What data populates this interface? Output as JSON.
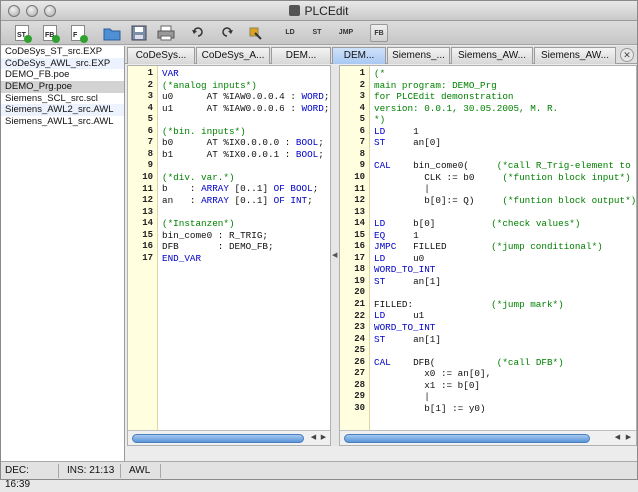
{
  "window": {
    "title": "PLCEdit"
  },
  "toolbar": {
    "new_st_label": "ST",
    "new_fb_label": "FB",
    "new_f_label": "F",
    "ld_label": "LD",
    "st_label": "ST",
    "jmp_label": "JMP",
    "fb_label": "FB"
  },
  "files": [
    "CoDeSys_ST_src.EXP",
    "CoDeSys_AWL_src.EXP",
    "DEMO_FB.poe",
    "DEMO_Prg.poe",
    "Siemens_SCL_src.scl",
    "Siemens_AWL2_src.AWL",
    "Siemens_AWL1_src.AWL"
  ],
  "tabs": [
    "CoDeSys...",
    "CoDeSys_A...",
    "DEM...",
    "DEM...",
    "Siemens_...",
    "Siemens_AW...",
    "Siemens_AW..."
  ],
  "left_code": [
    [
      [
        "kw",
        "VAR"
      ]
    ],
    [
      [
        "cm",
        "(*analog inputs*)"
      ]
    ],
    [
      [
        "",
        "u0      AT %IAW0.0.0.4 : "
      ],
      [
        "kw",
        "WORD"
      ],
      [
        "",
        ";"
      ]
    ],
    [
      [
        "",
        "u1      AT %IAW0.0.0.6 : "
      ],
      [
        "kw",
        "WORD"
      ],
      [
        "",
        ";"
      ]
    ],
    [],
    [
      [
        "cm",
        "(*bin. inputs*)"
      ]
    ],
    [
      [
        "",
        "b0      AT %IX0.0.0.0 : "
      ],
      [
        "kw",
        "BOOL"
      ],
      [
        "",
        ";"
      ]
    ],
    [
      [
        "",
        "b1      AT %IX0.0.0.1 : "
      ],
      [
        "kw",
        "BOOL"
      ],
      [
        "",
        ";"
      ]
    ],
    [],
    [
      [
        "cm",
        "(*div. var.*)"
      ]
    ],
    [
      [
        "",
        "b    : "
      ],
      [
        "kw",
        "ARRAY"
      ],
      [
        "",
        " [0..1] "
      ],
      [
        "kw",
        "OF"
      ],
      [
        "",
        " "
      ],
      [
        "kw",
        "BOOL"
      ],
      [
        "",
        ";"
      ]
    ],
    [
      [
        "",
        "an   : "
      ],
      [
        "kw",
        "ARRAY"
      ],
      [
        "",
        " [0..1] "
      ],
      [
        "kw",
        "OF"
      ],
      [
        "",
        " "
      ],
      [
        "kw",
        "INT"
      ],
      [
        "",
        ";"
      ]
    ],
    [],
    [
      [
        "cm",
        "(*Instanzen*)"
      ]
    ],
    [
      [
        "",
        "bin_come0 : R_TRIG;"
      ]
    ],
    [
      [
        "",
        "DFB       : DEMO_FB;"
      ]
    ],
    [
      [
        "kw",
        "END_VAR"
      ]
    ]
  ],
  "right_code": [
    [
      [
        "cm",
        "(*"
      ]
    ],
    [
      [
        "cm",
        "main program: DEMO_Prg"
      ]
    ],
    [
      [
        "cm",
        "for PLCEdit demonstration"
      ]
    ],
    [
      [
        "cm",
        "version: 0.0.1, 30.05.2005, M. R."
      ]
    ],
    [
      [
        "cm",
        "*)"
      ]
    ],
    [
      [
        "kw",
        "LD"
      ],
      [
        "",
        "     1"
      ]
    ],
    [
      [
        "kw",
        "ST"
      ],
      [
        "",
        "     an[0]"
      ]
    ],
    [],
    [
      [
        "kw",
        "CAL"
      ],
      [
        "",
        "    bin_come0(     "
      ],
      [
        "cm",
        "(*call R_Trig-element to utiliz"
      ]
    ],
    [
      [
        "",
        "         CLK := b0     "
      ],
      [
        "cm",
        "(*funtion block input*)"
      ]
    ],
    [
      [
        "",
        "         |"
      ]
    ],
    [
      [
        "",
        "         b[0]:= Q)     "
      ],
      [
        "cm",
        "(*funtion block output*)"
      ]
    ],
    [],
    [
      [
        "kw",
        "LD"
      ],
      [
        "",
        "     b[0]          "
      ],
      [
        "cm",
        "(*check values*)"
      ]
    ],
    [
      [
        "kw",
        "EQ"
      ],
      [
        "",
        "     1"
      ]
    ],
    [
      [
        "kw",
        "JMPC"
      ],
      [
        "",
        "   FILLED        "
      ],
      [
        "cm",
        "(*jump conditional*)"
      ]
    ],
    [
      [
        "kw",
        "LD"
      ],
      [
        "",
        "     u0"
      ]
    ],
    [
      [
        "kw",
        "WORD_TO_INT"
      ]
    ],
    [
      [
        "kw",
        "ST"
      ],
      [
        "",
        "     an[1]"
      ]
    ],
    [],
    [
      [
        "",
        "FILLED:              "
      ],
      [
        "cm",
        "(*jump mark*)"
      ]
    ],
    [
      [
        "kw",
        "LD"
      ],
      [
        "",
        "     u1"
      ]
    ],
    [
      [
        "kw",
        "WORD_TO_INT"
      ]
    ],
    [
      [
        "kw",
        "ST"
      ],
      [
        "",
        "     an[1]"
      ]
    ],
    [],
    [
      [
        "kw",
        "CAL"
      ],
      [
        "",
        "    DFB(           "
      ],
      [
        "cm",
        "(*call DFB*)"
      ]
    ],
    [
      [
        "",
        "         x0 := an[0],"
      ]
    ],
    [
      [
        "",
        "         x1 := b[0]"
      ]
    ],
    [
      [
        "",
        "         |"
      ]
    ],
    [
      [
        "",
        "         b[1] := y0)"
      ]
    ]
  ],
  "status": {
    "dec": "DEC: 16:39",
    "ins": "INS: 21:13",
    "lang": "AWL"
  },
  "colors": {
    "keyword": "#0000c8",
    "comment": "#008000",
    "gutter": "#ffffe0",
    "active_tab": "#a9c8f2"
  }
}
